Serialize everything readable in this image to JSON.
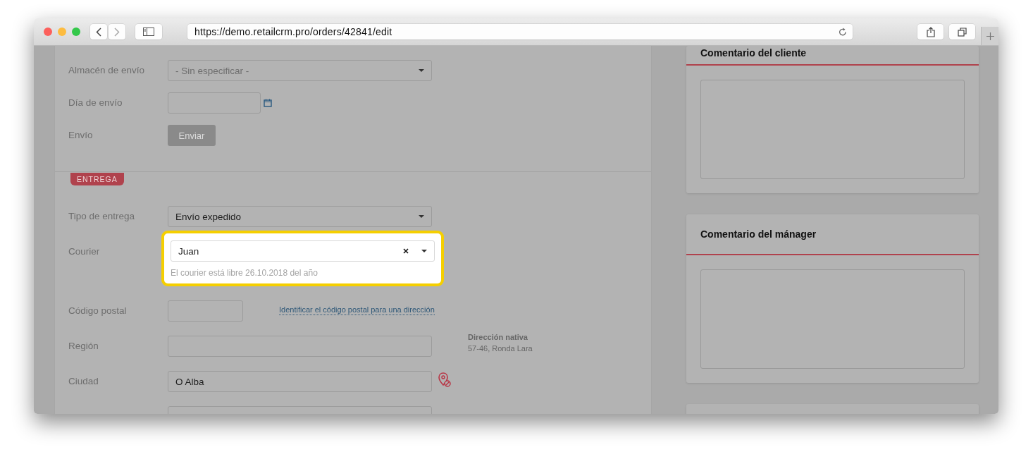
{
  "browser": {
    "url": "https://demo.retailcrm.pro/orders/42841/edit"
  },
  "shipping_section": {
    "fields": [
      {
        "kind": "select",
        "label": "Almacén de envío",
        "placeholder": "- Sin especificar -"
      },
      {
        "kind": "date",
        "label": "Día de envío"
      },
      {
        "kind": "button",
        "label": "Envío",
        "button": "Enviar",
        "disabled": true
      }
    ]
  },
  "delivery_section": {
    "badge": "ENTREGA",
    "fields": [
      {
        "kind": "select",
        "label": "Tipo de entrega",
        "value": "Envío expedido"
      },
      {
        "kind": "courier",
        "label": "Courier",
        "value": "Juan",
        "hint": "El courier está libre 26.10.2018 del año",
        "highlighted": true
      },
      {
        "kind": "postal",
        "label": "Código postal",
        "link": "Identificar el código postal para una dirección"
      },
      {
        "kind": "text",
        "label": "Región",
        "aside_title": "Dirección nativa",
        "aside_text": "57-46, Ronda Lara"
      },
      {
        "kind": "text",
        "label": "Ciudad",
        "value": "O Alba",
        "map_pin": true
      },
      {
        "kind": "text"
      }
    ]
  },
  "comments": [
    {
      "kind": "comment",
      "title": "Comentario del cliente"
    },
    {
      "kind": "comment",
      "title": "Comentario del mánager"
    },
    {
      "kind": "collapsed"
    }
  ]
}
